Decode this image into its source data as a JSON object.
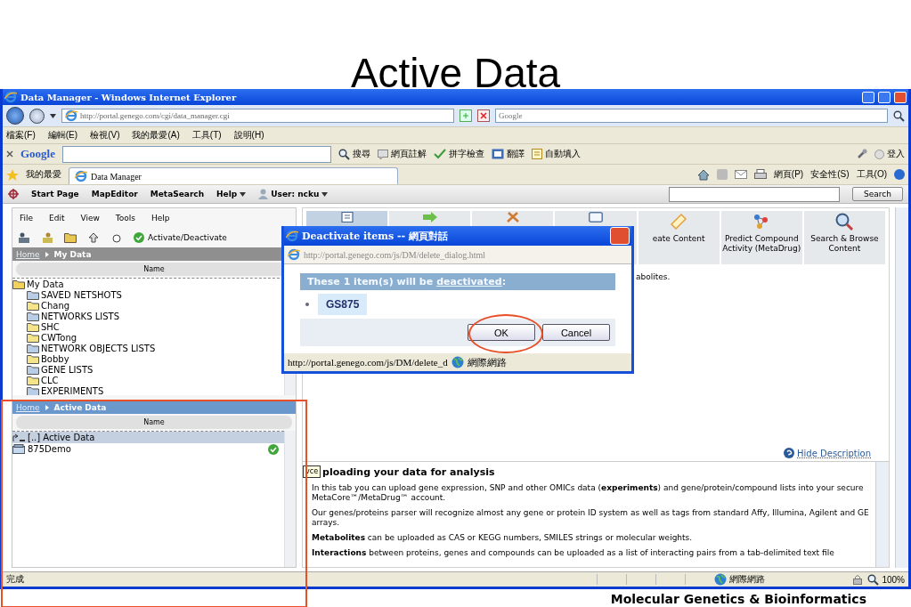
{
  "slide": {
    "title": "Active Data",
    "footer": "Molecular Genetics & Bioinformatics"
  },
  "browser": {
    "title": "Data Manager - Windows Internet Explorer",
    "address": "http://portal.genego.com/cgi/data_manager.cgi",
    "search_placeholder": "Google",
    "menu": [
      "檔案(F)",
      "編輯(E)",
      "檢視(V)",
      "我的最愛(A)",
      "工具(T)",
      "說明(H)"
    ],
    "google_toolbar": {
      "label": "Google",
      "items": [
        "搜尋",
        "網頁註解",
        "拼字檢查",
        "翻譯",
        "自動填入"
      ],
      "sign_in": "登入"
    },
    "favorites": {
      "label": "我的最愛",
      "tab": "Data Manager",
      "commands": [
        "網頁(P)",
        "安全性(S)",
        "工具(O)"
      ]
    },
    "status": {
      "text": "完成",
      "zone": "網際網路",
      "zoom": "100%"
    }
  },
  "nav": {
    "items": [
      {
        "label": "Start Page",
        "dropdown": false
      },
      {
        "label": "MapEditor",
        "dropdown": false
      },
      {
        "label": "MetaSearch",
        "dropdown": false
      },
      {
        "label": "Help",
        "dropdown": true
      }
    ],
    "user": "User: ncku",
    "search_button": "Search"
  },
  "left": {
    "menu": [
      "File",
      "Edit",
      "View",
      "Tools",
      "Help"
    ],
    "action": "Activate/Deactivate",
    "my_data": {
      "home": "Home",
      "current": "My Data",
      "column": "Name",
      "root": {
        "label": "My Data",
        "children": [
          {
            "label": "SAVED NETSHOTS",
            "kind": "system"
          },
          {
            "label": "Chang",
            "kind": "user"
          },
          {
            "label": "NETWORKS LISTS",
            "kind": "system"
          },
          {
            "label": "SHC",
            "kind": "user"
          },
          {
            "label": "CWTong",
            "kind": "user"
          },
          {
            "label": "NETWORK OBJECTS LISTS",
            "kind": "system"
          },
          {
            "label": "Bobby",
            "kind": "user"
          },
          {
            "label": "GENE LISTS",
            "kind": "system"
          },
          {
            "label": "CLC",
            "kind": "user"
          },
          {
            "label": "EXPERIMENTS",
            "kind": "system"
          }
        ]
      }
    },
    "active_data": {
      "home": "Home",
      "current": "Active Data",
      "column": "Name",
      "rows": [
        {
          "label": "[..] Active Data",
          "kind": "parent",
          "selected": true,
          "active": false
        },
        {
          "label": "875Demo",
          "kind": "dataset",
          "selected": false,
          "active": true
        }
      ]
    }
  },
  "right": {
    "tabs": [
      {
        "kind": "upload",
        "selected": true
      },
      {
        "kind": "arrow",
        "selected": false
      },
      {
        "kind": "tools",
        "selected": false
      },
      {
        "kind": "window",
        "selected": false
      },
      {
        "kind": "edit",
        "label": "eate Content",
        "selected": false
      },
      {
        "kind": "molecule",
        "label": "Predict Compound Activity (MetaDrug)",
        "selected": false
      },
      {
        "kind": "search",
        "label": "Search & Browse Content",
        "selected": false
      }
    ],
    "intro": "abolites.",
    "hide_link": "Hide Description",
    "description": {
      "tooltip": "vce",
      "heading": "ploading your data for analysis",
      "paragraphs": [
        "In this tab you can upload gene expression, SNP and other OMICs data (**experiments**) and gene/protein/compound lists into your secure MetaCore™/MetaDrug™ account.",
        "Our genes/proteins parser will recognize almost any gene or protein ID system as well as tags from standard Affy, Illumina, Agilent and GE arrays.",
        "**Metabolites** can be uploaded as CAS or KEGG numbers, SMILES strings or molecular weights.",
        "**Interactions** between proteins, genes and compounds can be uploaded as a list of interacting pairs from a tab-delimited text file"
      ]
    }
  },
  "dialog": {
    "title": "Deactivate items -- 網頁對話",
    "address": "http://portal.genego.com/js/DM/delete_dialog.html",
    "header_before": "These 1 item(s) will be",
    "header_link": "deactivated",
    "header_after": ":",
    "items": [
      "GS875"
    ],
    "buttons": [
      "OK",
      "Cancel"
    ],
    "status": "http://portal.genego.com/js/DM/delete_d",
    "zone": "網際網路"
  }
}
